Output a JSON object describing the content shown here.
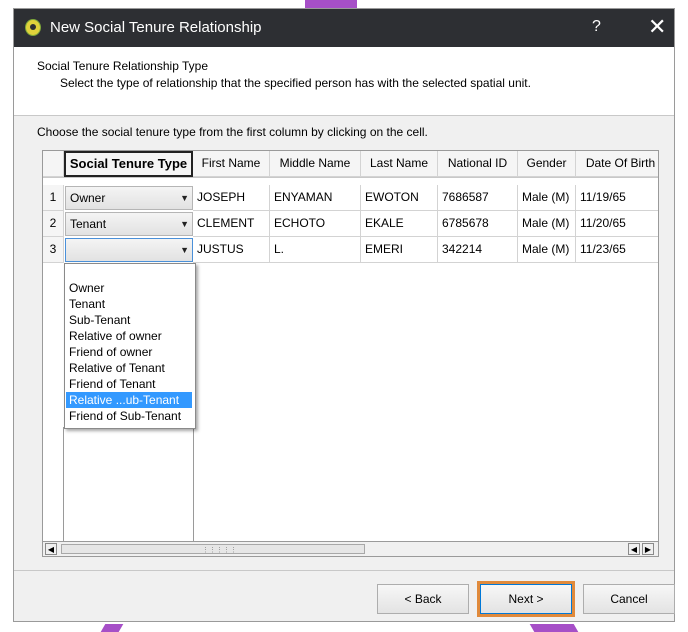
{
  "dialog": {
    "title": "New Social Tenure Relationship",
    "help_symbol": "?",
    "close_symbol": "✕"
  },
  "header": {
    "title": "Social Tenure Relationship Type",
    "subtitle": "Select the type of relationship that the specified person has with the selected spatial unit."
  },
  "instruction": "Choose the social tenure type from the first column by clicking on the cell.",
  "table": {
    "columns": [
      "Social Tenure Type",
      "First Name",
      "Middle Name",
      "Last Name",
      "National ID",
      "Gender",
      "Date Of Birth"
    ],
    "rows": [
      {
        "num": "1",
        "tenure": "Owner",
        "first": "JOSEPH",
        "middle": "ENYAMAN",
        "last": "EWOTON",
        "national_id": "7686587",
        "gender": "Male (M)",
        "dob": "11/19/65"
      },
      {
        "num": "2",
        "tenure": "Tenant",
        "first": "CLEMENT",
        "middle": "ECHOTO",
        "last": "EKALE",
        "national_id": "6785678",
        "gender": "Male (M)",
        "dob": "11/20/65"
      },
      {
        "num": "3",
        "tenure": "",
        "first": "JUSTUS",
        "middle": "L.",
        "last": "EMERI",
        "national_id": "342214",
        "gender": "Male (M)",
        "dob": "11/23/65"
      }
    ]
  },
  "dropdown": {
    "options": [
      "Owner",
      "Tenant",
      "Sub-Tenant",
      "Relative of owner",
      "Friend of owner",
      "Relative of Tenant",
      "Friend of Tenant",
      "Relative ...ub-Tenant",
      "Friend of Sub-Tenant"
    ],
    "highlighted_index": 7
  },
  "buttons": {
    "back": "< Back",
    "next": "Next >",
    "cancel": "Cancel"
  },
  "colors": {
    "titlebar": "#2d2f33",
    "selection": "#3399ff",
    "focus_highlight": "#e08a3c"
  }
}
